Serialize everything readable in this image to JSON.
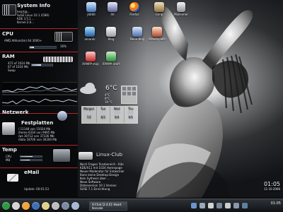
{
  "colors": {
    "accent_red": "#b5242b",
    "panel_dark": "#000000",
    "taskbar": "#1f2328"
  },
  "widgets": {
    "system": {
      "title": "System Info",
      "lines": [
        "heart@...",
        "SuSE Linux 10.1 (i586)",
        "KDE 3.5.1 ...",
        "Kernel 2.6..."
      ]
    },
    "cpu": {
      "title": "CPU",
      "lines": [
        "AMD Athlon(tm) 64 3000+",
        "16%"
      ],
      "usage_percent": 16
    },
    "ram": {
      "title": "RAM",
      "lines": [
        "472 of 1024 Mb",
        "67 of 1024 Mb",
        "Swap"
      ],
      "usage_percent": 46
    },
    "network": {
      "title": "Netzwerk"
    },
    "drives": {
      "title": "Festplatten",
      "lines": [
        "/ 11148 von 15024 Mb",
        "/home 6330 von 9995 Mb",
        "/ws 30712 von 37336 Mb",
        "/data 18700 von 30200 Mb"
      ]
    },
    "temp": {
      "title": "Temp",
      "lines": [
        "CPU",
        "MB"
      ]
    },
    "mail": {
      "title": "eMail",
      "lines": [
        "Update: 00:01:53"
      ]
    }
  },
  "desktop_icons": [
    {
      "name": "J4000",
      "icon": "computer-icon"
    },
    {
      "name": "IVI",
      "icon": "ivi-icon"
    },
    {
      "name": "Firefox",
      "icon": "firefox-icon"
    },
    {
      "name": "Gimp",
      "icon": "gimp-icon"
    },
    {
      "name": "Mülleimer",
      "icon": "trash-icon"
    },
    {
      "name": "amarok",
      "icon": "amarok-icon"
    },
    {
      "name": "Blog",
      "icon": "blog-icon"
    },
    {
      "name": "Neue Blog",
      "icon": "notes-icon"
    },
    {
      "name": "Arbeitsplatz",
      "icon": "home-icon"
    },
    {
      "name": "XAMPP stop",
      "icon": "xampp-icon"
    },
    {
      "name": "XAMPP Start",
      "icon": "xampp-icon"
    }
  ],
  "weather": {
    "temperature": "6°C",
    "details": [
      "4°C",
      "8°C",
      "10 °C"
    ],
    "days": [
      "Morgen",
      "Tue",
      "Wed",
      "Thu"
    ],
    "temps": [
      "7/2",
      "8/3",
      "9/4",
      "9/5"
    ]
  },
  "linux_club": {
    "title": "Linux-Club",
    "lines": [
      "Noch Fragen Tanzbereich - Kde",
      "KDE/X11 mit 1024 Homepage",
      "Neuer Moderator für Entwickler",
      "Kann keine Desktop-Design",
      "Kein Sythesis über ...",
      "Neue Software",
      "Dateiversion 10.1 Version",
      "SUSE 7.1 Einrichtung"
    ]
  },
  "clock": {
    "time": "01:05",
    "date": "11.10.2006"
  },
  "taskbar": {
    "window_label": "X-Chat [2.4.0]: Heart",
    "window_sublabel": "Konsole",
    "clock": "01:05"
  }
}
